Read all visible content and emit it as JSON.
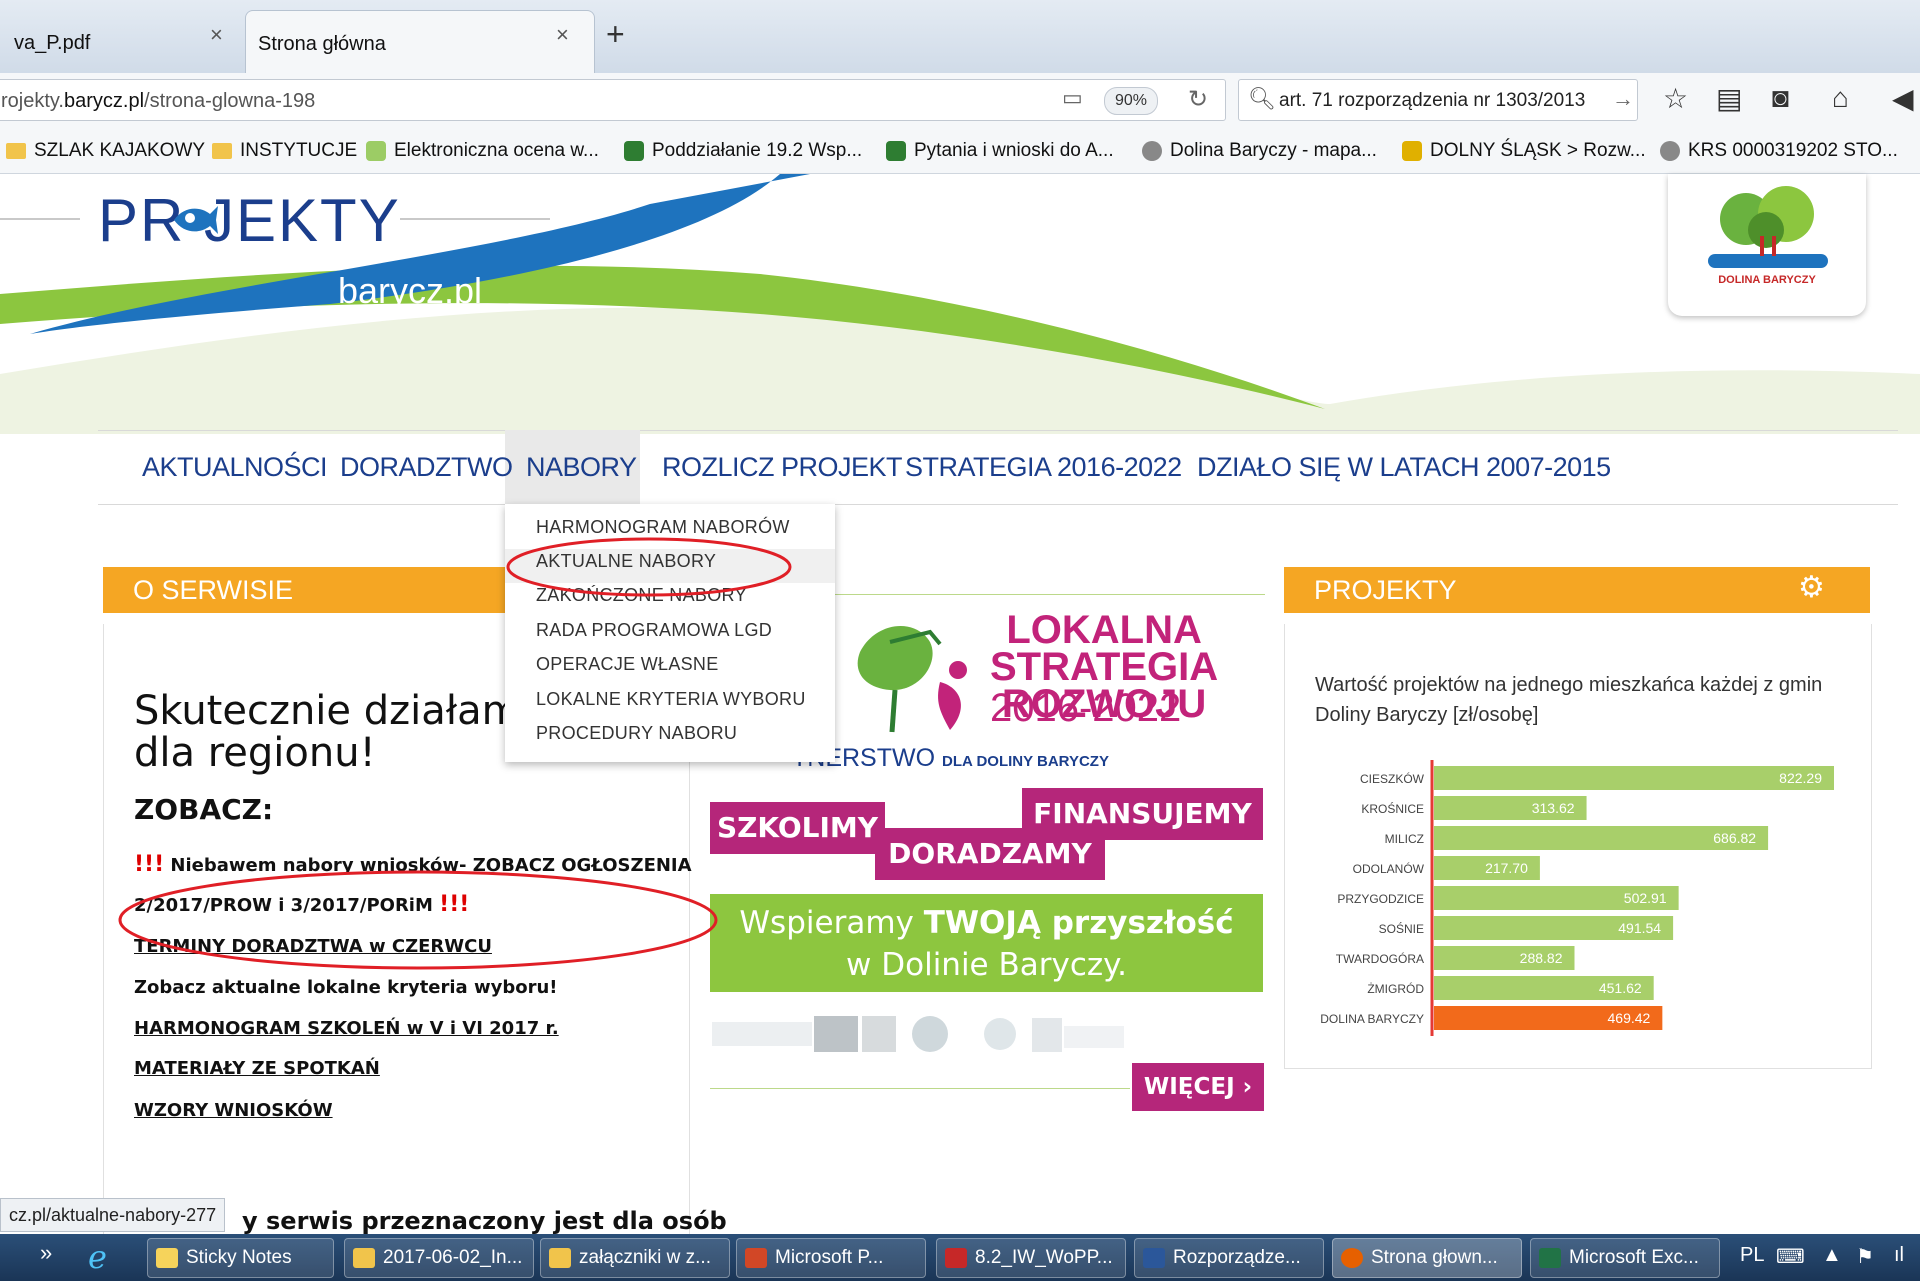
{
  "browser": {
    "tabs": [
      {
        "label": "va_P.pdf",
        "active": false
      },
      {
        "label": "Strona główna",
        "active": true
      }
    ],
    "new_tab": "+",
    "url_prefix": "rojekty.",
    "url_domain": "barycz.pl",
    "url_path": "/strona-glowna-198",
    "zoom": "90%",
    "search_value": "art. 71 rozporządzenia nr 1303/2013",
    "bookmarks": [
      {
        "label": "SZLAK KAJAKOWY",
        "icon": "folder-icon"
      },
      {
        "label": "INSTYTUCJE",
        "icon": "folder-icon"
      },
      {
        "label": "Elektroniczna ocena w...",
        "icon": "site-icon"
      },
      {
        "label": "Poddziałanie 19.2 Wsp...",
        "icon": "site-icon"
      },
      {
        "label": "Pytania i wnioski do A...",
        "icon": "site-icon"
      },
      {
        "label": "Dolina Baryczy - mapa...",
        "icon": "globe-icon"
      },
      {
        "label": "DOLNY ŚLĄSK > Rozw...",
        "icon": "crest-icon"
      },
      {
        "label": "KRS 0000319202 STO...",
        "icon": "globe-icon"
      }
    ]
  },
  "header": {
    "logo_title": "PR  JEKTY",
    "logo_subtitle": "barycz.pl",
    "partner_logo_caption": "DOLINA BARYCZY"
  },
  "menu": {
    "items": [
      "AKTUALNOŚCI",
      "DORADZTWO",
      "NABORY",
      "ROZLICZ PROJEKT",
      "STRATEGIA 2016-2022",
      "DZIAŁO SIĘ W LATACH 2007-2015"
    ],
    "active": "NABORY",
    "dropdown": [
      "HARMONOGRAM NABORÓW",
      "AKTUALNE NABORY",
      "ZAKOŃCZONE NABORY",
      "RADA PROGRAMOWA LGD",
      "OPERACJE WŁASNE",
      "LOKALNE KRYTERIA WYBORU",
      "PROCEDURY NABORU"
    ]
  },
  "left": {
    "header": "O SERWISIE",
    "headline_1": "Skutecznie działamy n",
    "headline_2": "dla regionu!",
    "zobacz": "ZOBACZ:",
    "excl": "!!!",
    "line1": "Niebawem nabory wniosków- ZOBACZ OGŁOSZENIA",
    "line2": "2/2017/PROW i 3/2017/PORiM",
    "line3": "TERMINY DORADZTWA w CZERWCU",
    "line4": "Zobacz aktualne lokalne kryteria wyboru!",
    "line5": "HARMONOGRAM SZKOLEŃ w V i VI 2017 r.",
    "line6": "MATERIAŁY ZE SPOTKAŃ",
    "line7": "WZORY WNIOSKÓW",
    "bottom": "y serwis przeznaczony jest dla osób"
  },
  "center": {
    "lsr_1": "LOKALNA",
    "lsr_2": "STRATEGIA",
    "lsr_3": "ROZWOJU",
    "lsr_years": "2016-2022",
    "partner_main": "TNERSTWO",
    "partner_small": "DLA DOLINY BARYCZY",
    "szkolimy": "SZKOLIMY",
    "finansujemy": "FINANSUJEMY",
    "doradzamy": "DORADZAMY",
    "wspieramy_1": "Wspieramy ",
    "wspieramy_bold": "TWOJĄ przyszłość",
    "wspieramy_2": "w Dolinie Baryczy.",
    "more": "WIĘCEJ ›"
  },
  "right": {
    "header": "PROJEKTY",
    "caption": "Wartość projektów na jednego mieszkańca każdej z gmin Doliny Baryczy [zł/osobę]"
  },
  "chart_data": {
    "type": "bar",
    "orientation": "horizontal",
    "title": "Wartość projektów na jednego mieszkańca każdej z gmin Doliny Baryczy [zł/osobę]",
    "categories": [
      "CIESZKÓW",
      "KROŚNICE",
      "MILICZ",
      "ODOLANÓW",
      "PRZYGODZICE",
      "SOŚNIE",
      "TWARDOGÓRA",
      "ŻMIGRÓD",
      "DOLINA BARYCZY"
    ],
    "values": [
      822.29,
      313.62,
      686.82,
      217.7,
      502.91,
      491.54,
      288.82,
      451.62,
      469.42
    ],
    "labels": [
      "822.29",
      "313.62",
      "686.82",
      "217.70",
      "502.91",
      "491.54",
      "288.82",
      "451.62",
      "469.42"
    ],
    "colors": {
      "default": "#a8cf6a",
      "highlight": "#f26a1b",
      "axis": "#e53935"
    },
    "highlight_index": 8,
    "xlim": [
      0,
      822.29
    ]
  },
  "status": {
    "hover_url": "cz.pl/aktualne-nabory-277"
  },
  "taskbar": {
    "items": [
      {
        "label": "Sticky Notes",
        "color": "#f6d35b"
      },
      {
        "label": "2017-06-02_In...",
        "color": "#f1c44b"
      },
      {
        "label": "załączniki w z...",
        "color": "#f1c44b"
      },
      {
        "label": "Microsoft P...",
        "color": "#d24726"
      },
      {
        "label": "8.2_IW_WoPP...",
        "color": "#c62828"
      },
      {
        "label": "Rozporządze...",
        "color": "#2b579a"
      },
      {
        "label": "Strona głown...",
        "color": "#e66000"
      },
      {
        "label": "Microsoft Exc...",
        "color": "#217346"
      }
    ],
    "lang": "PL"
  }
}
